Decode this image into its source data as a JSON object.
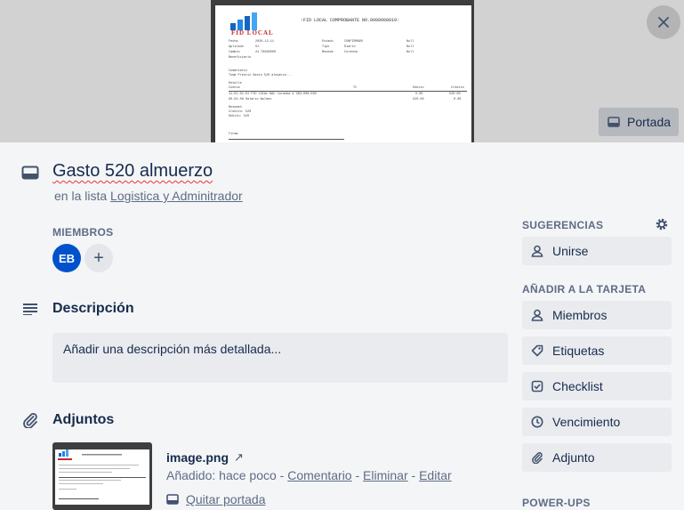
{
  "card": {
    "title": "Gasto 520 almuerzo",
    "list_prefix": "en la lista",
    "list_name": "Logistica y Adminitrador"
  },
  "cover": {
    "button_label": "Portada",
    "document": {
      "logo_text": "FID LOCAL",
      "heading": ":FID LOCAL COMPROBANTE NO.0000000019:",
      "fields_left": [
        "Fecha",
        "Aplicado",
        "Cambio",
        "Beneficiario"
      ],
      "values_left": [
        "2020-12-11",
        "Si",
        "24.78965000",
        ""
      ],
      "fields_right": [
        "Estado",
        "Tipo",
        "Moneda"
      ],
      "values_right": [
        "CONFIRMADO",
        "Diario",
        "Cordoba"
      ],
      "flags": [
        "Null",
        "Null",
        "Null"
      ],
      "comment_label": "Comentario",
      "comment_text": "Toma Prestic Gasto 520 almuerzo...",
      "detail_label": "Detalle",
      "detail_headers": [
        "Cuenta",
        "TC",
        "Debito",
        "Credito"
      ],
      "detail_rows": [
        [
          "11-01-01-01 FID LOCAL BAC Cordoba # 363-008-030",
          "",
          "0.00",
          "520.00"
        ],
        [
          "60-04-08 Salario Woldes",
          "",
          "520.00",
          "0.00"
        ]
      ],
      "summary_label": "Resumen",
      "summary_rows": [
        "Credito:  520",
        "Debito:   520"
      ],
      "sign_label": "Firma"
    }
  },
  "members": {
    "heading": "MIEMBROS",
    "avatar_initials": "EB",
    "avatar_color": "#0052cc",
    "add_symbol": "+"
  },
  "description": {
    "heading": "Descripción",
    "placeholder": "Añadir una descripción más detallada..."
  },
  "attachments": {
    "heading": "Adjuntos",
    "items": [
      {
        "name": "image.png",
        "ext_icon": "↗",
        "added": "Añadido: hace poco",
        "sep": " - ",
        "comment_link": "Comentario",
        "delete_link": "Eliminar",
        "edit_link": "Editar",
        "remove_cover": "Quitar portada"
      }
    ]
  },
  "sidebar": {
    "suggestions_heading": "SUGERENCIAS",
    "join_label": "Unirse",
    "add_heading": "AÑADIR A LA TARJETA",
    "buttons": [
      "Miembros",
      "Etiquetas",
      "Checklist",
      "Vencimiento",
      "Adjunto"
    ],
    "powerups_heading": "POWER-UPS"
  },
  "colors": {
    "background": "#f4f5f7",
    "text": "#172b4d",
    "muted": "#5e6c84",
    "button_bg": "#e9ebee",
    "avatar": "#0052cc"
  }
}
